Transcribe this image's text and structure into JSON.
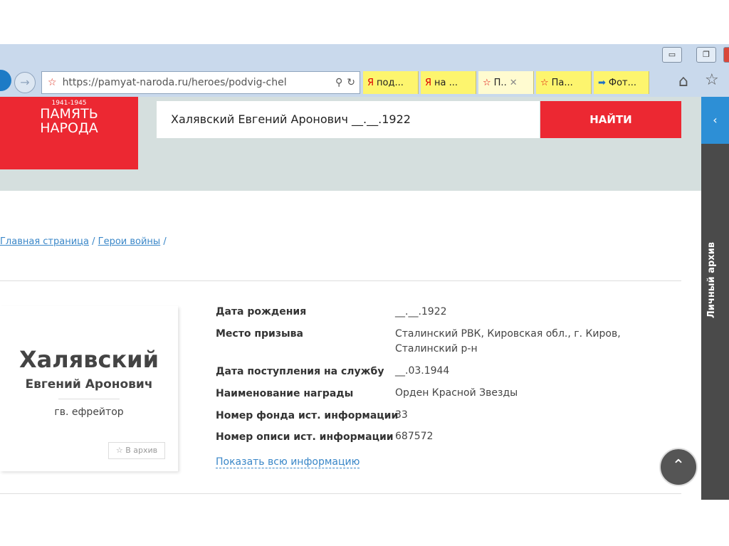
{
  "browser": {
    "url": "https://pamyat-naroda.ru/heroes/podvig-chel",
    "tabs": [
      "под...",
      "на ...",
      "П..",
      "Па...",
      "Фот..."
    ]
  },
  "logo": {
    "years": "1941-1945",
    "line1": "ПАМЯТЬ",
    "line2": "НАРОДА"
  },
  "search": {
    "value": "Халявский Евгений Аронович __.__.1922",
    "button": "НАЙТИ"
  },
  "side": {
    "archive": "Личный архив"
  },
  "breadcrumb": [
    "Главная страница",
    "Герои войны"
  ],
  "person": {
    "surname": "Халявский",
    "name": "Евгений Аронович",
    "rank": "гв. ефрейтор",
    "archive_button": "В архив"
  },
  "details": [
    {
      "label": "Дата рождения",
      "value": "__.__.1922"
    },
    {
      "label": "Место призыва",
      "value": "Сталинский РВК, Кировская обл., г. Киров, Сталинский р-н"
    },
    {
      "label": "Дата поступления на службу",
      "value": "__.03.1944"
    },
    {
      "label": "Наименование награды",
      "value": "Орден Красной Звезды"
    },
    {
      "label": "Номер фонда ист. информации",
      "value": "33"
    },
    {
      "label": "Номер описи ист. информации",
      "value": "687572"
    }
  ],
  "show_all": "Показать всю информацию"
}
